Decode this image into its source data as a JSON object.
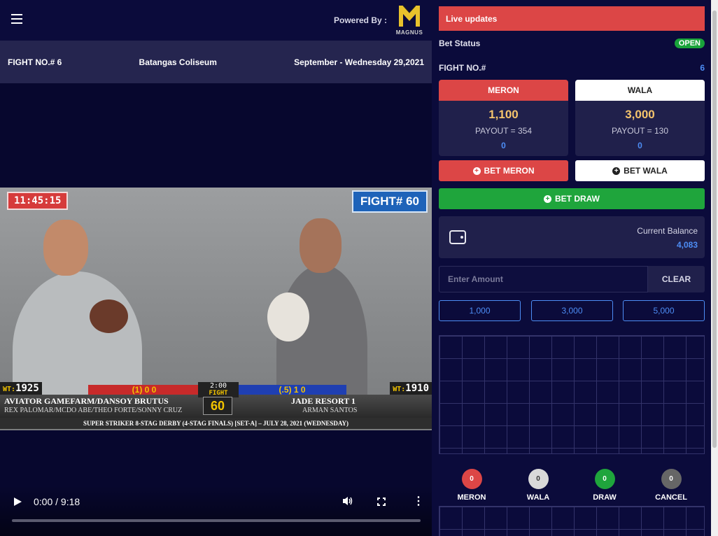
{
  "header": {
    "powered_by": "Powered By :",
    "logo_text": "MAGNUS"
  },
  "fight_bar": {
    "fight_no": "FIGHT NO.# 6",
    "venue": "Batangas Coliseum",
    "date": "September - Wednesday 29,2021"
  },
  "video": {
    "clock": "11:45:15",
    "fight_badge": "FIGHT# 60",
    "wt_label": "WT:",
    "wt_left": "1925",
    "wt_right": "1910",
    "score_left": "(1) 0 0",
    "score_right": "(.5) 1 0",
    "timer": "2:00",
    "timer_label": "FIGHT",
    "left_name": "AVIATOR GAMEFARM/DANSOY BRUTUS",
    "left_sub": "REX PALOMAR/MCDO ABE/THEO FORTE/SONNY CRUZ",
    "right_name": "JADE RESORT 1",
    "right_sub": "ARMAN SANTOS",
    "fight_number": "60",
    "event": "SUPER STRIKER 8-STAG DERBY (4-STAG FINALS) [SET-A] – JULY 28, 2021 (WEDNESDAY)",
    "time_display": "0:00 / 9:18",
    "progress": 0
  },
  "panel": {
    "live_updates": "Live updates",
    "bet_status_label": "Bet Status",
    "bet_status": "OPEN",
    "fight_no_label": "FIGHT NO.#",
    "fight_no": "6",
    "meron": {
      "label": "MERON",
      "amount": "1,100",
      "payout": "PAYOUT = 354",
      "my_bet": "0"
    },
    "wala": {
      "label": "WALA",
      "amount": "3,000",
      "payout": "PAYOUT = 130",
      "my_bet": "0"
    },
    "bet_meron": "BET MERON",
    "bet_wala": "BET WALA",
    "bet_draw": "BET DRAW",
    "balance_label": "Current Balance",
    "balance": "4,083",
    "amount_placeholder": "Enter Amount",
    "clear": "CLEAR",
    "quick_amounts": [
      "1,000",
      "3,000",
      "5,000"
    ],
    "tally": [
      {
        "label": "MERON",
        "count": "0"
      },
      {
        "label": "WALA",
        "count": "0"
      },
      {
        "label": "DRAW",
        "count": "0"
      },
      {
        "label": "CANCEL",
        "count": "0"
      }
    ]
  },
  "colors": {
    "background": "#0b0b3b",
    "meron": "#dc4646",
    "wala": "#ffffff",
    "draw": "#1fa53c",
    "accent": "#4d8df5",
    "gold": "#f5c46c"
  },
  "icons": [
    "menu-icon",
    "magnus-logo",
    "play-icon",
    "volume-icon",
    "fullscreen-icon",
    "more-vert-icon",
    "plus-circle-icon",
    "wallet-icon"
  ]
}
